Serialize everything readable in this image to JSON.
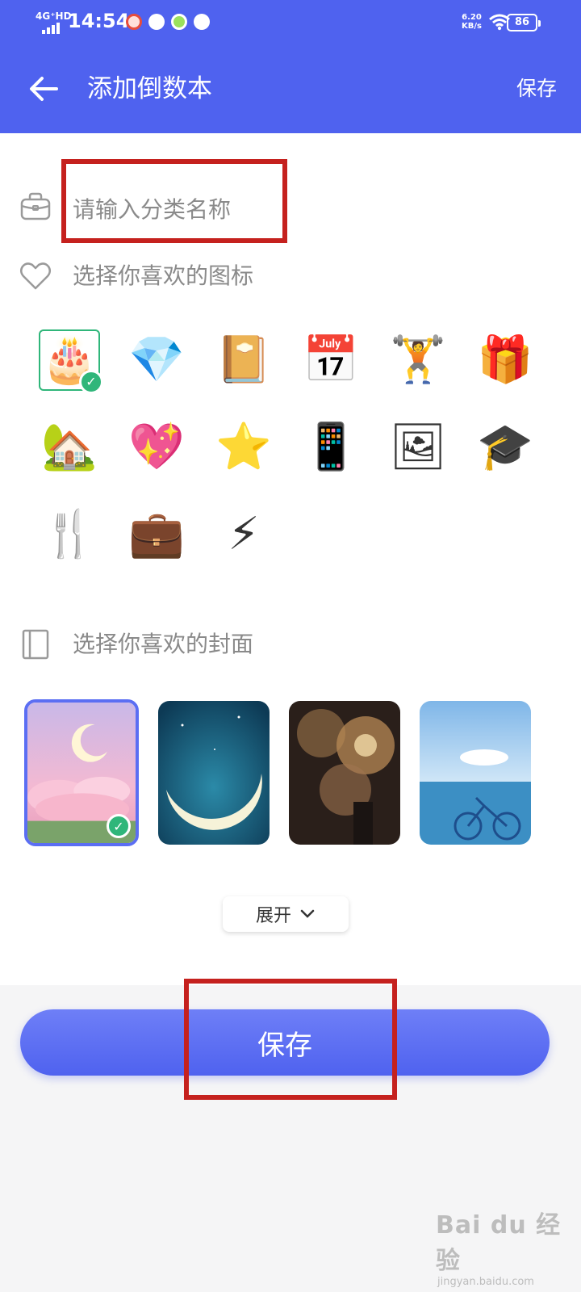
{
  "status_bar": {
    "network": "4G⁺HD",
    "time": "14:54",
    "speed": "6.20\nKB/s",
    "battery": "86"
  },
  "header": {
    "title": "添加倒数本",
    "save_label": "保存"
  },
  "category": {
    "placeholder": "请输入分类名称",
    "value": ""
  },
  "icons_section": {
    "label": "选择你喜欢的图标",
    "items": [
      {
        "name": "birthday-cake",
        "glyph": "🎂",
        "selected": true
      },
      {
        "name": "diamond",
        "glyph": "💎",
        "selected": false
      },
      {
        "name": "notebook",
        "glyph": "📔",
        "selected": false
      },
      {
        "name": "calendar-star",
        "glyph": "📅",
        "selected": false
      },
      {
        "name": "dumbbell",
        "glyph": "🏋",
        "selected": false
      },
      {
        "name": "gift",
        "glyph": "🎁",
        "selected": false
      },
      {
        "name": "house",
        "glyph": "🏡",
        "selected": false
      },
      {
        "name": "sparkling-heart",
        "glyph": "💖",
        "selected": false
      },
      {
        "name": "star",
        "glyph": "⭐",
        "selected": false
      },
      {
        "name": "phone",
        "glyph": "📱",
        "selected": false
      },
      {
        "name": "picture",
        "glyph": "🖼",
        "selected": false
      },
      {
        "name": "graduation-cap",
        "glyph": "🎓",
        "selected": false
      },
      {
        "name": "fork-knife",
        "glyph": "🍴",
        "selected": false
      },
      {
        "name": "briefcase",
        "glyph": "💼",
        "selected": false
      },
      {
        "name": "lightning",
        "glyph": "⚡",
        "selected": false
      }
    ]
  },
  "covers_section": {
    "label": "选择你喜欢的封面",
    "items": [
      {
        "name": "pink-moon",
        "selected": true
      },
      {
        "name": "night-moon",
        "selected": false
      },
      {
        "name": "fireworks",
        "selected": false
      },
      {
        "name": "seaside-bicycle",
        "selected": false
      }
    ]
  },
  "expand_label": "展开",
  "footer": {
    "save_label": "保存"
  },
  "watermark": {
    "main": "Bai du 经验",
    "sub": "jingyan.baidu.com"
  },
  "colors": {
    "accent": "#4f62ef",
    "highlight_box": "#c5211e",
    "selected_check": "#2fb67a"
  }
}
